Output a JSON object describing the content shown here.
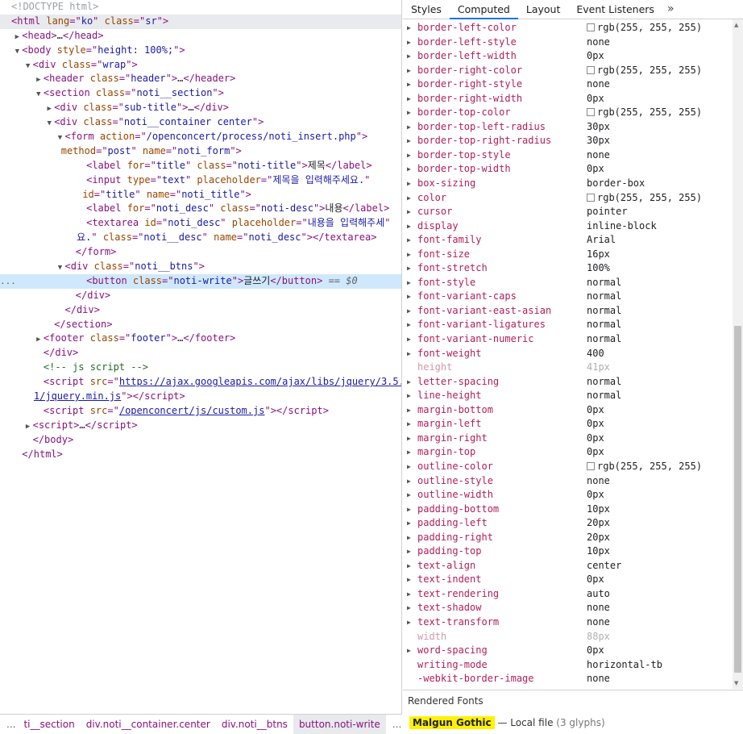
{
  "elements_panel": {
    "lines": [
      {
        "indent": 0,
        "tri": "none",
        "kind": "doctype",
        "text": "<!DOCTYPE html>"
      },
      {
        "indent": 0,
        "tri": "none",
        "kind": "open",
        "tag": "html",
        "attrs": [
          [
            "lang",
            "ko"
          ],
          [
            "class",
            "sr"
          ]
        ],
        "highlight": "root"
      },
      {
        "indent": 1,
        "tri": "closed",
        "kind": "collapsed",
        "tag": "head",
        "attrs": []
      },
      {
        "indent": 1,
        "tri": "open",
        "kind": "open",
        "tag": "body",
        "attrs": [
          [
            "style",
            "height: 100%;"
          ]
        ]
      },
      {
        "indent": 2,
        "tri": "open",
        "kind": "open",
        "tag": "div",
        "attrs": [
          [
            "class",
            "wrap"
          ]
        ]
      },
      {
        "indent": 3,
        "tri": "closed",
        "kind": "collapsed",
        "tag": "header",
        "attrs": [
          [
            "class",
            "header"
          ]
        ]
      },
      {
        "indent": 3,
        "tri": "open",
        "kind": "open",
        "tag": "section",
        "attrs": [
          [
            "class",
            "noti__section"
          ]
        ]
      },
      {
        "indent": 4,
        "tri": "closed",
        "kind": "collapsed",
        "tag": "div",
        "attrs": [
          [
            "class",
            "sub-title"
          ]
        ]
      },
      {
        "indent": 4,
        "tri": "open",
        "kind": "open",
        "tag": "div",
        "attrs": [
          [
            "class",
            "noti__container center"
          ]
        ]
      },
      {
        "indent": 5,
        "tri": "open",
        "kind": "open",
        "tag": "form",
        "attrs": [
          [
            "action",
            "/openconcert/process/noti_insert.php"
          ]
        ]
      },
      {
        "indent": 5,
        "tri": "none",
        "kind": "cont",
        "attrs": [
          [
            "method",
            "post"
          ],
          [
            "name",
            "noti_form"
          ]
        ],
        "close": true
      },
      {
        "indent": 7,
        "tri": "none",
        "kind": "element_text",
        "tag": "label",
        "attrs": [
          [
            "for",
            "title"
          ],
          [
            "class",
            "noti-title"
          ]
        ],
        "text": "제목"
      },
      {
        "indent": 7,
        "tri": "none",
        "kind": "open",
        "tag": "input",
        "attrs": [
          [
            "type",
            "text"
          ],
          [
            "placeholder",
            "제목을 입력해주세요."
          ]
        ],
        "noclose": true
      },
      {
        "indent": 7,
        "tri": "none",
        "kind": "cont",
        "attrs": [
          [
            "id",
            "title"
          ],
          [
            "name",
            "noti_title"
          ]
        ],
        "close": true
      },
      {
        "indent": 7,
        "tri": "none",
        "kind": "element_text",
        "tag": "label",
        "attrs": [
          [
            "for",
            "noti_desc"
          ],
          [
            "class",
            "noti-desc"
          ]
        ],
        "text": "내용"
      },
      {
        "indent": 7,
        "tri": "none",
        "kind": "open",
        "tag": "textarea",
        "attrs": [
          [
            "id",
            "noti_desc"
          ],
          [
            "placeholder",
            "내용을 입력해주세"
          ]
        ],
        "noclose": true,
        "unterminated": true
      },
      {
        "indent": 7,
        "tri": "none",
        "kind": "textarea_cont",
        "text_before": "요.",
        "attrs": [
          [
            "class",
            "noti__desc"
          ],
          [
            "name",
            "noti_desc"
          ]
        ],
        "endtag": "textarea"
      },
      {
        "indent": 6,
        "tri": "none",
        "kind": "close",
        "tag": "form"
      },
      {
        "indent": 5,
        "tri": "open",
        "kind": "open",
        "tag": "div",
        "attrs": [
          [
            "class",
            "noti__btns"
          ]
        ]
      },
      {
        "indent": 7,
        "tri": "none",
        "kind": "element_text",
        "tag": "button",
        "attrs": [
          [
            "class",
            "noti-write"
          ]
        ],
        "text": "글쓰기",
        "highlight": "selected",
        "suffix": " == $0"
      },
      {
        "indent": 6,
        "tri": "none",
        "kind": "close",
        "tag": "div"
      },
      {
        "indent": 5,
        "tri": "none",
        "kind": "close",
        "tag": "div"
      },
      {
        "indent": 4,
        "tri": "none",
        "kind": "close",
        "tag": "section"
      },
      {
        "indent": 3,
        "tri": "closed",
        "kind": "collapsed",
        "tag": "footer",
        "attrs": [
          [
            "class",
            "footer"
          ]
        ]
      },
      {
        "indent": 3,
        "tri": "none",
        "kind": "close",
        "tag": "div"
      },
      {
        "indent": 3,
        "tri": "none",
        "kind": "comment",
        "text": "<!-- js script -->"
      },
      {
        "indent": 3,
        "tri": "none",
        "kind": "script_link",
        "tag": "script",
        "attr": "src",
        "link": "https://ajax.googleapis.com/ajax/libs/jquery/3.5.",
        "wrap": true
      },
      {
        "indent": 3,
        "tri": "none",
        "kind": "script_link_cont",
        "link": "1/jquery.min.js",
        "tag": "script"
      },
      {
        "indent": 3,
        "tri": "none",
        "kind": "script_link",
        "tag": "script",
        "attr": "src",
        "link": "/openconcert/js/custom.js",
        "wrap": false
      },
      {
        "indent": 2,
        "tri": "closed",
        "kind": "collapsed",
        "tag": "script",
        "attrs": []
      },
      {
        "indent": 2,
        "tri": "none",
        "kind": "close",
        "tag": "body"
      },
      {
        "indent": 1,
        "tri": "none",
        "kind": "close",
        "tag": "html"
      }
    ],
    "selected_marker": "...",
    "collapsed_ellipsis": "…"
  },
  "breadcrumbs": {
    "ellipsis": "...",
    "items": [
      {
        "label": "ti__section",
        "active": false
      },
      {
        "label": "div.noti__container.center",
        "active": false
      },
      {
        "label": "div.noti__btns",
        "active": false
      },
      {
        "label": "button.noti-write",
        "active": true
      }
    ],
    "trailing": "..."
  },
  "side_panel": {
    "tabs": [
      {
        "label": "Styles",
        "active": false
      },
      {
        "label": "Computed",
        "active": true
      },
      {
        "label": "Layout",
        "active": false
      },
      {
        "label": "Event Listeners",
        "active": false
      }
    ],
    "more_tabs_icon": "»",
    "computed": [
      {
        "name": "border-left-color",
        "value": "rgb(255, 255, 255)",
        "swatch": "#ffffff"
      },
      {
        "name": "border-left-style",
        "value": "none"
      },
      {
        "name": "border-left-width",
        "value": "0px"
      },
      {
        "name": "border-right-color",
        "value": "rgb(255, 255, 255)",
        "swatch": "#ffffff"
      },
      {
        "name": "border-right-style",
        "value": "none"
      },
      {
        "name": "border-right-width",
        "value": "0px"
      },
      {
        "name": "border-top-color",
        "value": "rgb(255, 255, 255)",
        "swatch": "#ffffff"
      },
      {
        "name": "border-top-left-radius",
        "value": "30px"
      },
      {
        "name": "border-top-right-radius",
        "value": "30px"
      },
      {
        "name": "border-top-style",
        "value": "none"
      },
      {
        "name": "border-top-width",
        "value": "0px"
      },
      {
        "name": "box-sizing",
        "value": "border-box"
      },
      {
        "name": "color",
        "value": "rgb(255, 255, 255)",
        "swatch": "#ffffff"
      },
      {
        "name": "cursor",
        "value": "pointer"
      },
      {
        "name": "display",
        "value": "inline-block"
      },
      {
        "name": "font-family",
        "value": "Arial"
      },
      {
        "name": "font-size",
        "value": "16px"
      },
      {
        "name": "font-stretch",
        "value": "100%"
      },
      {
        "name": "font-style",
        "value": "normal"
      },
      {
        "name": "font-variant-caps",
        "value": "normal"
      },
      {
        "name": "font-variant-east-asian",
        "value": "normal"
      },
      {
        "name": "font-variant-ligatures",
        "value": "normal"
      },
      {
        "name": "font-variant-numeric",
        "value": "normal"
      },
      {
        "name": "font-weight",
        "value": "400"
      },
      {
        "name": "height",
        "value": "41px",
        "dim": true
      },
      {
        "name": "letter-spacing",
        "value": "normal"
      },
      {
        "name": "line-height",
        "value": "normal"
      },
      {
        "name": "margin-bottom",
        "value": "0px"
      },
      {
        "name": "margin-left",
        "value": "0px"
      },
      {
        "name": "margin-right",
        "value": "0px"
      },
      {
        "name": "margin-top",
        "value": "0px"
      },
      {
        "name": "outline-color",
        "value": "rgb(255, 255, 255)",
        "swatch": "#ffffff"
      },
      {
        "name": "outline-style",
        "value": "none"
      },
      {
        "name": "outline-width",
        "value": "0px"
      },
      {
        "name": "padding-bottom",
        "value": "10px"
      },
      {
        "name": "padding-left",
        "value": "20px"
      },
      {
        "name": "padding-right",
        "value": "20px"
      },
      {
        "name": "padding-top",
        "value": "10px"
      },
      {
        "name": "text-align",
        "value": "center"
      },
      {
        "name": "text-indent",
        "value": "0px"
      },
      {
        "name": "text-rendering",
        "value": "auto"
      },
      {
        "name": "text-shadow",
        "value": "none"
      },
      {
        "name": "text-transform",
        "value": "none"
      },
      {
        "name": "width",
        "value": "88px",
        "dim": true
      },
      {
        "name": "word-spacing",
        "value": "0px"
      },
      {
        "name": "writing-mode",
        "value": "horizontal-tb",
        "notri": true
      },
      {
        "name": "-webkit-border-image",
        "value": "none",
        "notri": true
      }
    ],
    "rendered_fonts": {
      "header": "Rendered Fonts",
      "font_name": "Malgun Gothic",
      "dash": "—",
      "source": "Local file",
      "count": "(3 glyphs)"
    }
  }
}
